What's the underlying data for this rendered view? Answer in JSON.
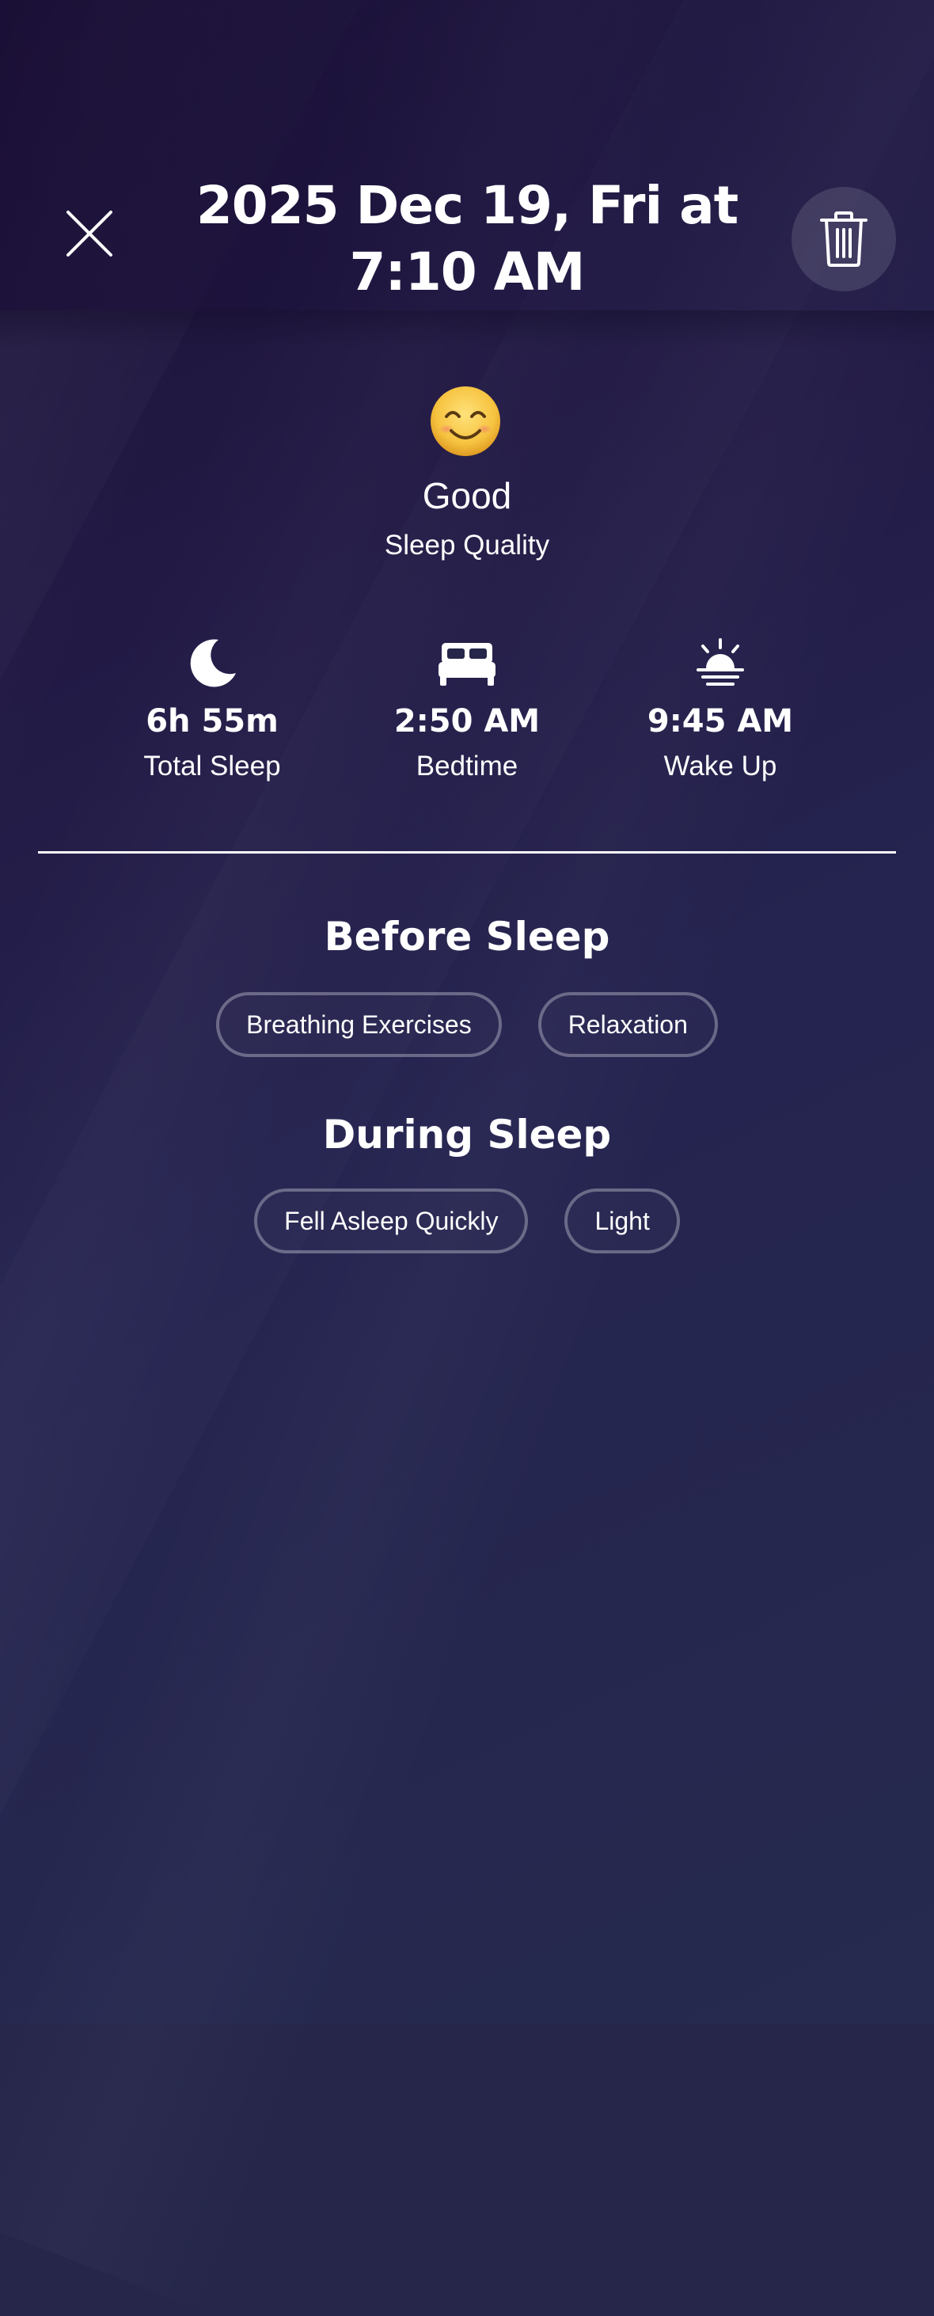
{
  "header": {
    "title_line1": "2025 Dec 19, Fri at",
    "title_line2": "7:10 AM"
  },
  "icons": {
    "close": "close-icon",
    "delete": "trash-icon",
    "quality": "smiling-face-emoji",
    "total_sleep": "moon-icon",
    "bedtime": "bed-icon",
    "wake_up": "sunrise-icon"
  },
  "quality": {
    "value": "Good",
    "caption": "Sleep Quality"
  },
  "stats": [
    {
      "value": "6h 55m",
      "label": "Total Sleep"
    },
    {
      "value": "2:50 AM",
      "label": "Bedtime"
    },
    {
      "value": "9:45 AM",
      "label": "Wake Up"
    }
  ],
  "before_sleep": {
    "title": "Before Sleep",
    "tags": [
      "Breathing Exercises",
      "Relaxation"
    ]
  },
  "during_sleep": {
    "title": "During Sleep",
    "tags": [
      "Fell Asleep Quickly",
      "Light"
    ]
  },
  "colors": {
    "background_dark": "#1d1238",
    "background_mid": "#25264a",
    "text": "#ffffff",
    "chip_border": "#5b5a7c",
    "emoji_yellow": "#f6c340"
  }
}
